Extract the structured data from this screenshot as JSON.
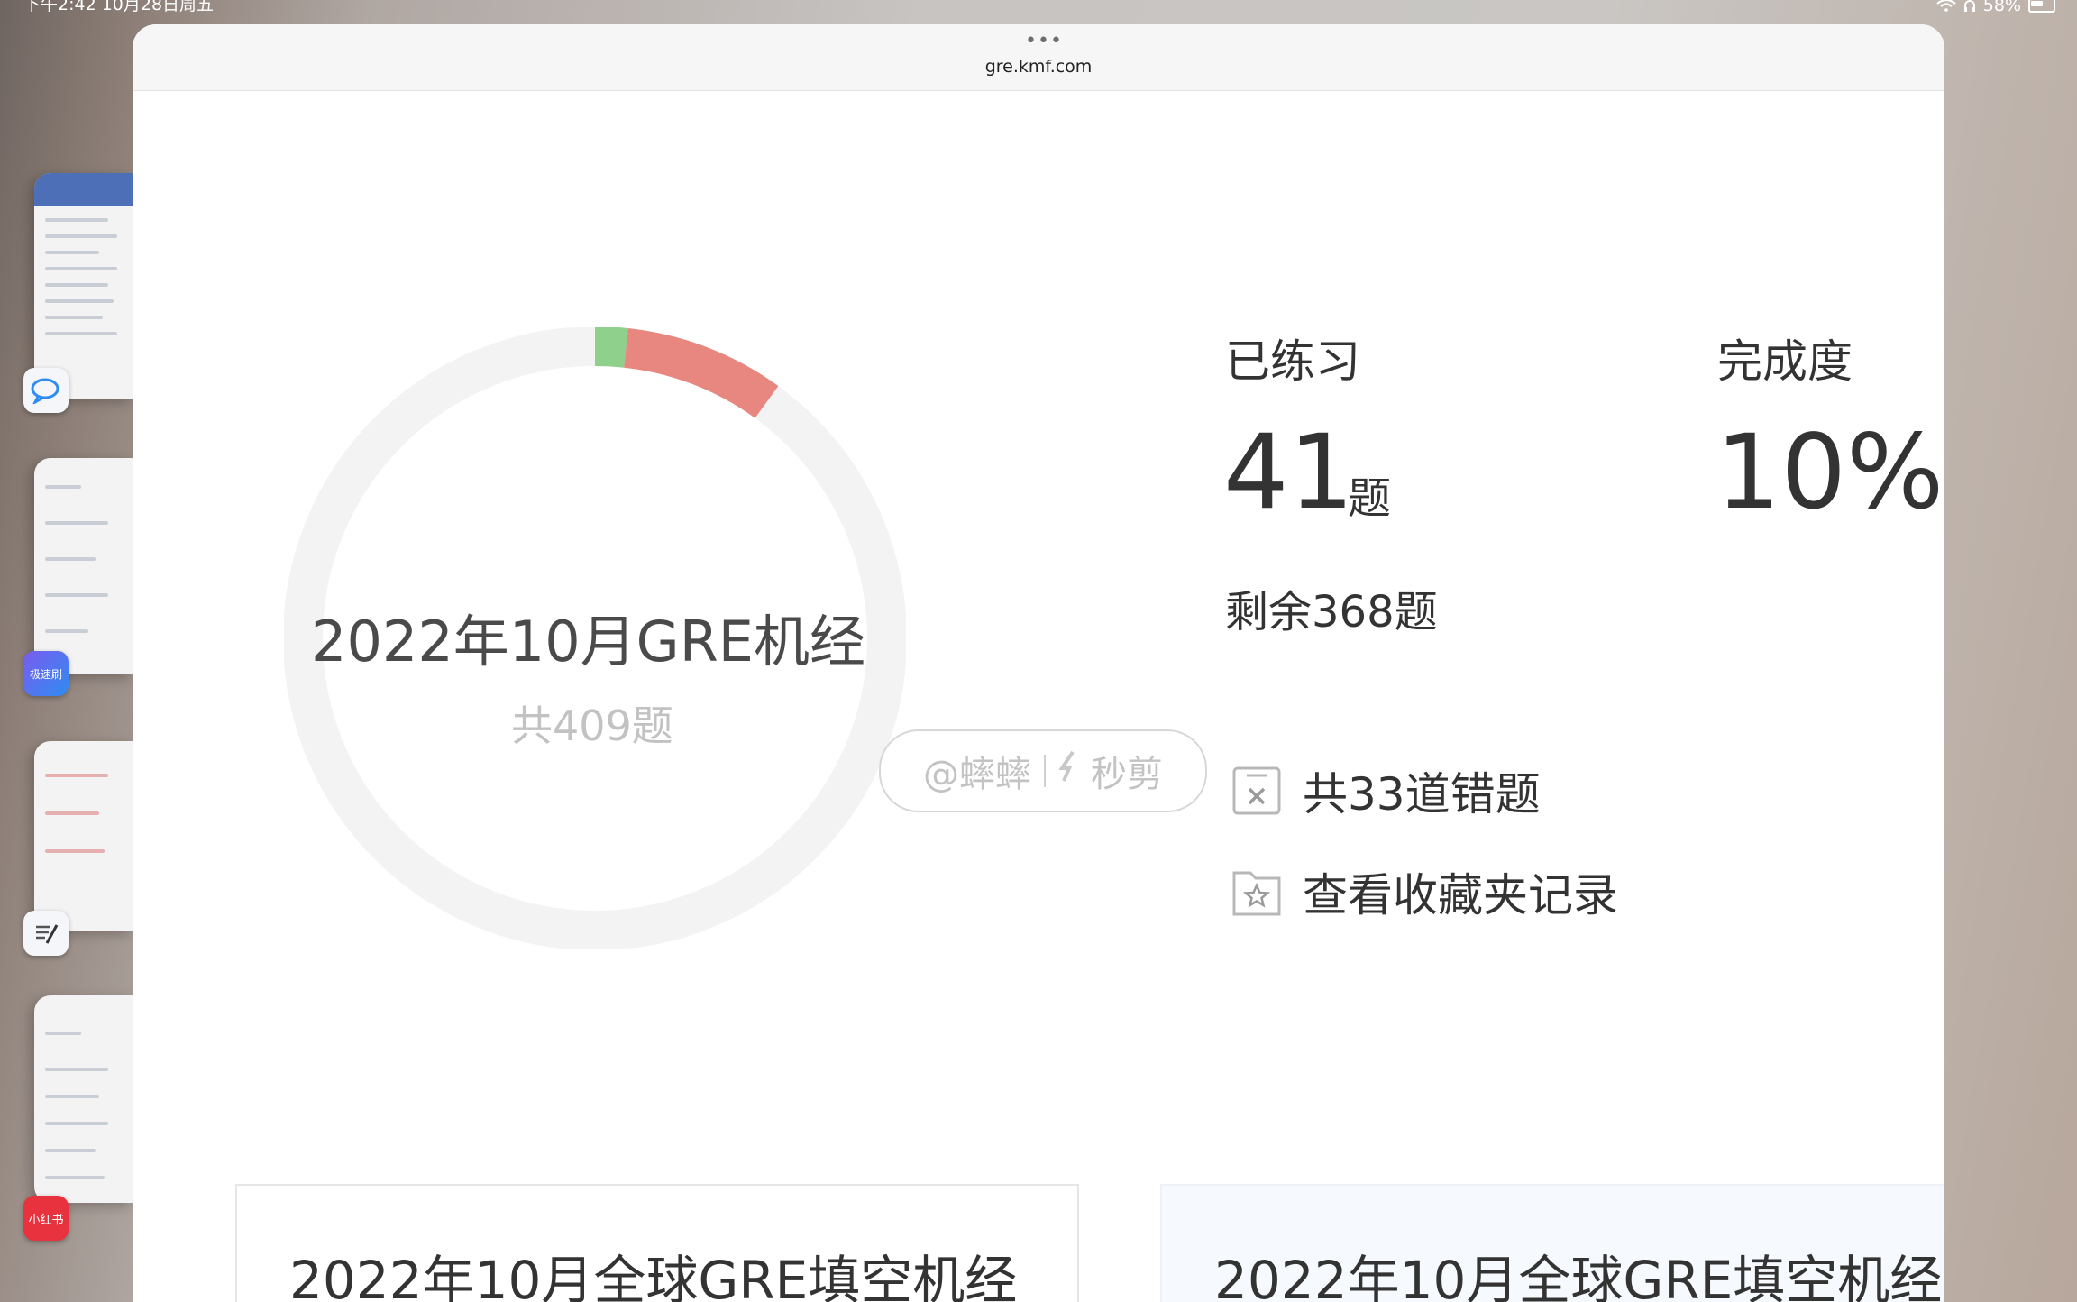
{
  "statusbar": {
    "time_date": "下午2:42  10月28日周五",
    "battery": "58%"
  },
  "browser": {
    "url": "gre.kmf.com"
  },
  "progress": {
    "title": "2022年10月GRE机经",
    "total": "共409题",
    "completion_fraction": 0.1,
    "correct_fraction": 0.017,
    "wrong_fraction": 0.083,
    "colors": {
      "track": "#f3f3f3",
      "correct": "#8fd08c",
      "wrong": "#e88680"
    }
  },
  "stats": {
    "practiced_label": "已练习",
    "practiced_value": "41",
    "practiced_unit": "题",
    "remaining": "剩余368题",
    "completion_label": "完成度",
    "completion_value": "10%"
  },
  "watermark": {
    "account": "@蟀蟀",
    "app": "秒剪"
  },
  "actions": [
    {
      "label": "共33道错题",
      "icon": "wrong-questions-icon"
    },
    {
      "label": "查看收藏夹记录",
      "icon": "favorites-folder-icon"
    }
  ],
  "cards": [
    {
      "title": "2022年10月全球GRE填空机经"
    },
    {
      "title": "2022年10月全球GRE填空机经"
    }
  ],
  "switcher_apps": [
    {
      "label": "",
      "icon": "chat-bubble-icon"
    },
    {
      "label": "极速刷",
      "icon": "app-icon-purple"
    },
    {
      "label": "",
      "icon": "notes-pen-icon"
    },
    {
      "label": "小红书",
      "icon": "xiaohongshu-icon"
    }
  ]
}
